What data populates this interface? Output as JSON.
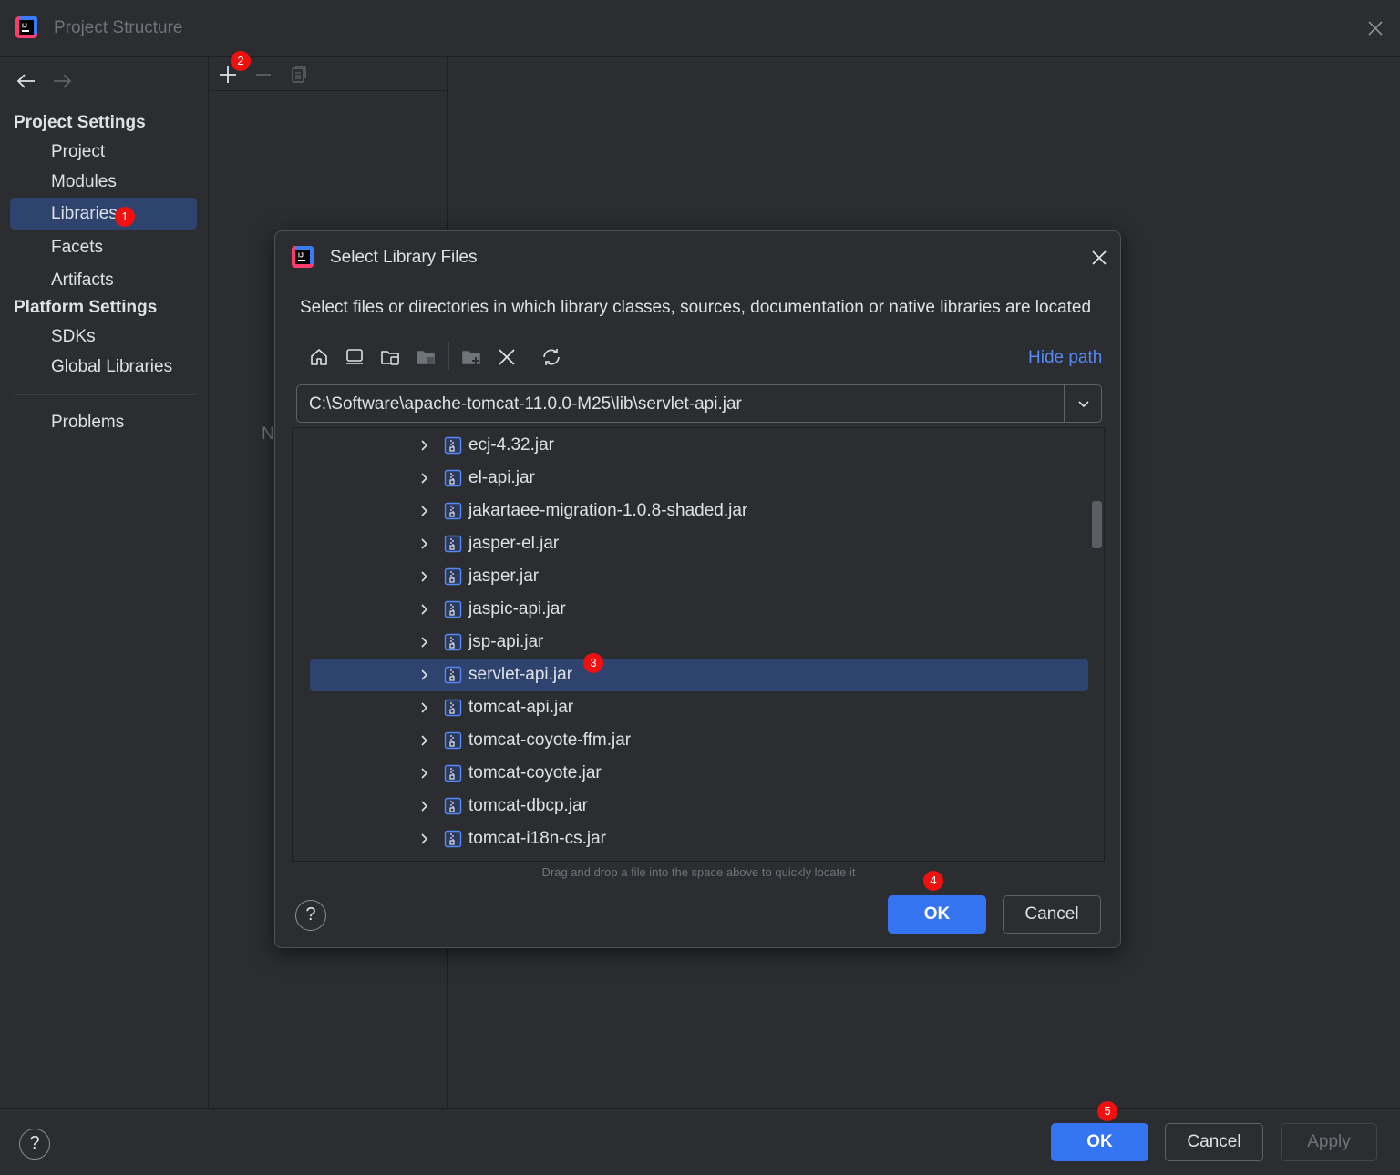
{
  "window": {
    "title": "Project Structure"
  },
  "sidebar": {
    "project_settings_header": "Project Settings",
    "platform_settings_header": "Platform Settings",
    "items": [
      {
        "label": "Project"
      },
      {
        "label": "Modules"
      },
      {
        "label": "Libraries",
        "selected": true
      },
      {
        "label": "Facets"
      },
      {
        "label": "Artifacts"
      },
      {
        "label": "SDKs"
      },
      {
        "label": "Global Libraries"
      },
      {
        "label": "Problems"
      }
    ]
  },
  "middle": {
    "toolbar": {
      "add_icon": "plus-icon",
      "remove_icon": "minus-icon",
      "copy_icon": "copy-icon"
    },
    "placeholder": "N"
  },
  "dialog": {
    "title": "Select Library Files",
    "description": "Select files or directories in which library classes, sources, documentation or native libraries are located",
    "toolbar": {
      "icons": [
        "home-icon",
        "desktop-icon",
        "project-folder-icon",
        "module-folder-icon",
        "new-folder-icon",
        "delete-icon",
        "refresh-icon"
      ],
      "hide_path": "Hide path"
    },
    "path": "C:\\Software\\apache-tomcat-11.0.0-M25\\lib\\servlet-api.jar",
    "tree": [
      {
        "label": "ecj-4.32.jar"
      },
      {
        "label": "el-api.jar"
      },
      {
        "label": "jakartaee-migration-1.0.8-shaded.jar"
      },
      {
        "label": "jasper-el.jar"
      },
      {
        "label": "jasper.jar"
      },
      {
        "label": "jaspic-api.jar"
      },
      {
        "label": "jsp-api.jar"
      },
      {
        "label": "servlet-api.jar",
        "selected": true
      },
      {
        "label": "tomcat-api.jar"
      },
      {
        "label": "tomcat-coyote-ffm.jar"
      },
      {
        "label": "tomcat-coyote.jar"
      },
      {
        "label": "tomcat-dbcp.jar"
      },
      {
        "label": "tomcat-i18n-cs.jar"
      }
    ],
    "drag_hint": "Drag and drop a file into the space above to quickly locate it",
    "help": "?",
    "ok": "OK",
    "cancel": "Cancel"
  },
  "bottom": {
    "help": "?",
    "ok": "OK",
    "cancel": "Cancel",
    "apply": "Apply"
  },
  "annotations": [
    "1",
    "2",
    "3",
    "4",
    "5"
  ],
  "colors": {
    "background": "#2b2d30",
    "selection": "#2e436e",
    "accent": "#3574f0",
    "link": "#548af7",
    "badge": "#f01010"
  }
}
